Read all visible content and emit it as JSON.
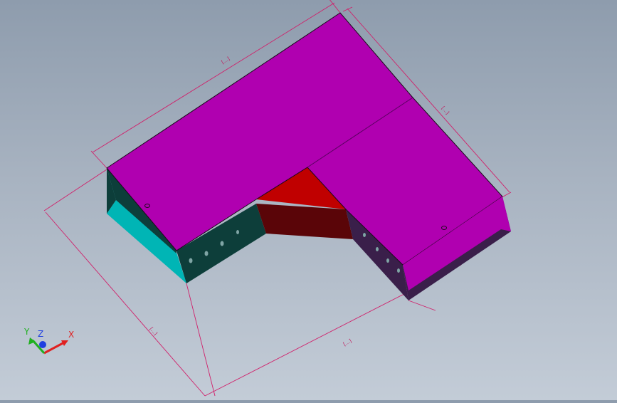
{
  "colors": {
    "background_top": "#8e9cad",
    "background_bottom": "#c3ccd7",
    "top_face": "#b000b0",
    "red_face": "#c00000",
    "dark_red_face": "#5a0508",
    "dark_teal_face": "#0d3e3a",
    "cyan_face": "#00b5b5",
    "dark_purple_face": "#3a1f4a",
    "dimension_line": "#d0206a"
  },
  "dimensions": {
    "top_length": "[...]",
    "right_width": "[...]",
    "left_depth": "[...]",
    "bottom_length": "[...]"
  },
  "triad": {
    "x_label": "X",
    "y_label": "Y",
    "z_label": "Z",
    "x_color": "#e02020",
    "y_color": "#20b020",
    "z_color": "#2040e0"
  }
}
